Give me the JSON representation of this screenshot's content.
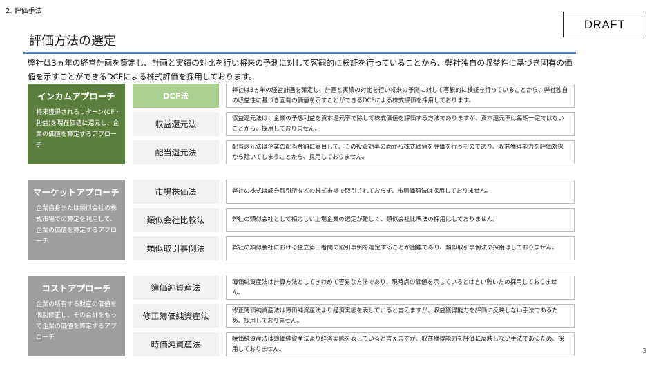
{
  "header": {
    "section_label": "2. 評価手法",
    "draft": "DRAFT",
    "title": "評価方法の選定",
    "intro": "弊社は3ヵ年の経営計画を策定し、計画と実績の対比を行い将来の予測に対して客観的に検証を行っていることから、弊社独自の収益性に基づき固有の価値を示すことができるDCFによる株式評価を採用しております。"
  },
  "approaches": [
    {
      "title": "インカムアプローチ",
      "description": "将来獲得されるリターン(CF・利益)を現在価値に還元し、企業の価値を算定するアプローチ",
      "color": "#5b7f3e"
    },
    {
      "title": "マーケットアプローチ",
      "description": "企業自身または類似会社の株式市場での算定を利用して、企業の価値を算定するアプローチ",
      "color": "#9e9e9e"
    },
    {
      "title": "コストアプローチ",
      "description": "企業の所有する財産の価値を個別修正し、その合計をもって企業の価値を算定するアプローチ",
      "color": "#9e9e9e"
    }
  ],
  "methods": [
    {
      "name": "DCF法",
      "selected": true,
      "description": "弊社は3ヵ年の経営計画を策定し、計画と実績の対比を行い将来の予測に対して客観的に検証を行っていることから、弊社独自の収益性に基づき固有の価値を示すことができるDCFによる株式評価を採用しております。"
    },
    {
      "name": "収益還元法",
      "selected": false,
      "description": "収益還元法は、企業の予想利益を資本還元率で除して株式価値を評価する方法でありますが、資本還元率は毎期一定ではないことから、採用しておりません。"
    },
    {
      "name": "配当還元法",
      "selected": false,
      "description": "配当還元法は企業の配当金額に着目して、その投資効率の面から株式価値を評価を行うものであり、収益獲得能力を評価対象から除いてしまうことから、採用しておりません。"
    },
    {
      "name": "市場株価法",
      "selected": false,
      "description": "弊社の株式は証券取引所などの株式市場で取引されておらず、市場価額法は採用しておりません。"
    },
    {
      "name": "類似会社比較法",
      "selected": false,
      "description": "弊社の類似会社として相応しい上場企業の選定が難しく、類似会社比準法の採用はしておりません。"
    },
    {
      "name": "類似取引事例法",
      "selected": false,
      "description": "弊社の類似会社における独立第三者間の取引事例を選定することが困難であり、類似取引事例法の採用はしておりません。"
    },
    {
      "name": "簿価純資産法",
      "selected": false,
      "description": "簿価純資産法は計算方法としてきわめて容易な方法であり、現時点の価値を示しているとは言い難いため採用しておりません。"
    },
    {
      "name": "修正簿価純資産法",
      "selected": false,
      "description": "修正簿価純資産法は簿価純資産法より経済実態を表していると言えますが、収益獲得能力を評価に反映しない手法であるため、採用しておりません。"
    },
    {
      "name": "時価純資産法",
      "selected": false,
      "description": "時価純資産法は簿価純資産法より経済実態を表していると言えますが、収益獲得能力を評価に反映しない手法であるため、採用しておりません。"
    }
  ],
  "footer": {
    "page_number": "3"
  }
}
